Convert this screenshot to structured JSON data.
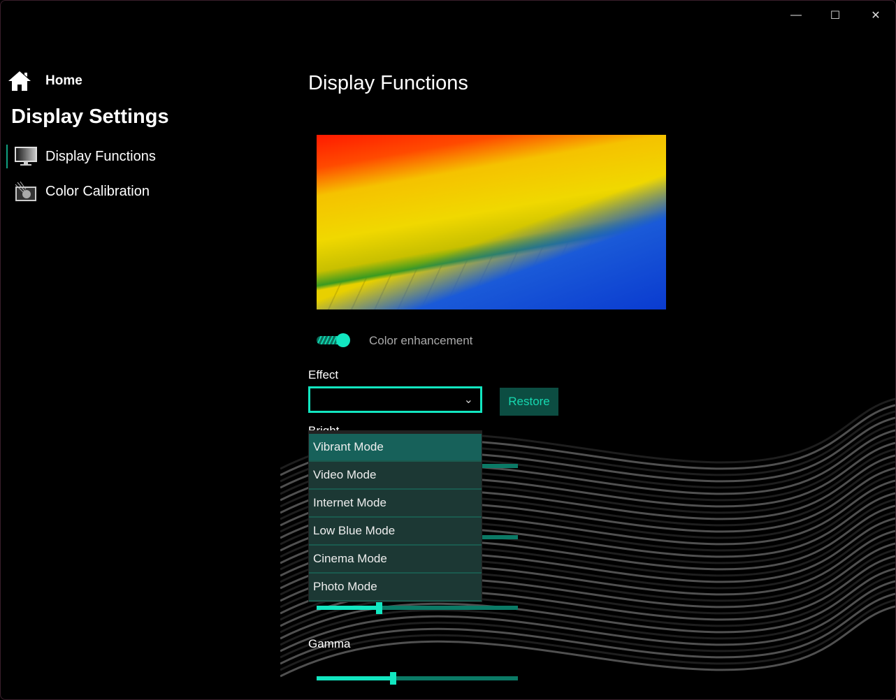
{
  "window": {
    "minimize": "—",
    "maximize": "☐",
    "close": "✕"
  },
  "sidebar": {
    "home": "Home",
    "title": "Display Settings",
    "items": [
      {
        "label": "Display Functions",
        "icon": "monitor-icon",
        "selected": true
      },
      {
        "label": "Color Calibration",
        "icon": "calibration-icon",
        "selected": false
      }
    ]
  },
  "main": {
    "title": "Display Functions",
    "toggle": {
      "label": "Color enhancement",
      "on": true
    },
    "effect": {
      "label": "Effect",
      "value": "",
      "restore": "Restore",
      "options": [
        "Vibrant Mode",
        "Video Mode",
        "Internet Mode",
        "Low Blue Mode",
        "Cinema Mode",
        "Photo Mode"
      ],
      "highlighted": "Vibrant Mode"
    },
    "brightness_label": "Bright",
    "gamma": {
      "label": "Gamma",
      "percent": 38
    },
    "slider3_percent": 31,
    "accent": "#12e6c0"
  }
}
